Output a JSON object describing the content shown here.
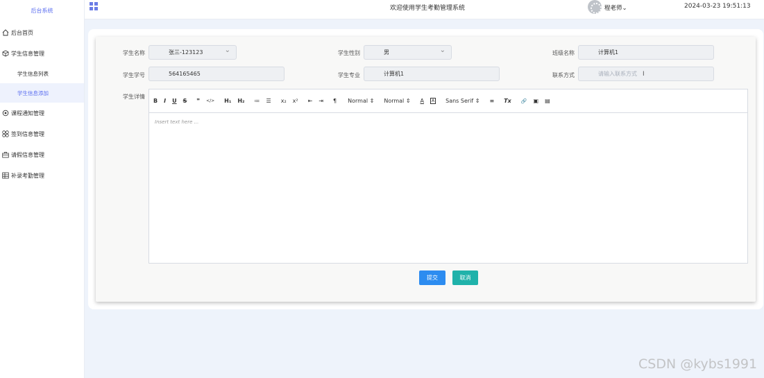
{
  "sidebar": {
    "brand": "后台系统",
    "items": [
      {
        "label": "后台首页",
        "icon": "home-icon"
      },
      {
        "label": "学生信息管理",
        "icon": "cube-icon"
      },
      {
        "label": "学生信息列表",
        "icon": ""
      },
      {
        "label": "学生信息添加",
        "icon": ""
      },
      {
        "label": "课程通知管理",
        "icon": "target-icon"
      },
      {
        "label": "签到信息管理",
        "icon": "grid-dots-icon"
      },
      {
        "label": "请假信息管理",
        "icon": "briefcase-icon"
      },
      {
        "label": "补录考勤管理",
        "icon": "table-icon"
      }
    ]
  },
  "header": {
    "welcome": "欢迎使用学生考勤管理系统",
    "user": "程老师⌄",
    "datetime": "2024-03-23 19:51:13"
  },
  "form": {
    "name_label": "学生名称",
    "name_value": "张三-123123",
    "gender_label": "学生性别",
    "gender_value": "男",
    "class_label": "班级名称",
    "class_value": "计算机1",
    "id_label": "学生学号",
    "id_value": "564165465",
    "major_label": "学生专业",
    "major_value": "计算机1",
    "contact_label": "联系方式",
    "contact_placeholder": "请输入联系方式",
    "detail_label": "学生详情"
  },
  "editor": {
    "toolbar": [
      "B",
      "I",
      "U",
      "S",
      "❞",
      "</>",
      "H₁",
      "H₂",
      "≔",
      "☰",
      "x₂",
      "x²",
      "⇤",
      "⇥",
      "¶",
      "Normal ⇕",
      "Normal ⇕",
      "A",
      "A",
      "Sans Serif ⇕",
      "≡",
      "Tx",
      "🔗",
      "▣",
      "▤"
    ],
    "placeholder": "Insert text here ..."
  },
  "buttons": {
    "submit": "提交",
    "cancel": "取消"
  },
  "watermark": "CSDN @kybs1991"
}
